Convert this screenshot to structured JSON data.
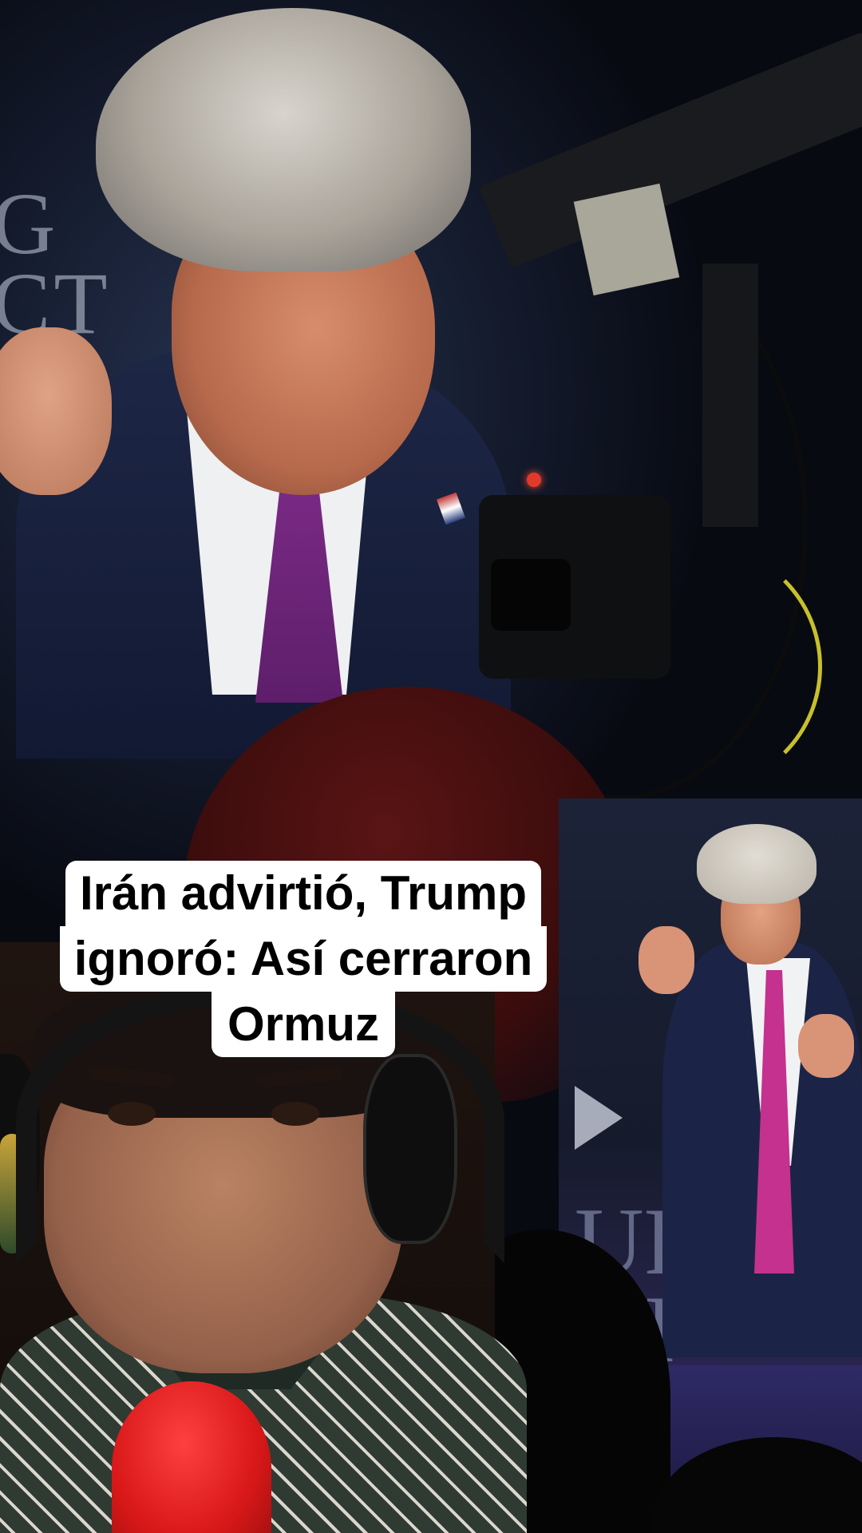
{
  "caption": {
    "line1": "Irán advirtió, Trump",
    "line2": "ignoró: Así cerraron",
    "line3": "Ormuz"
  },
  "background_text": {
    "left_letters": "G\nCT",
    "right_letters": "UR\nOI"
  },
  "colors": {
    "caption_bg": "#ffffff",
    "caption_text": "#000000",
    "tie": "#7b2b86",
    "mic": "#d81818"
  }
}
